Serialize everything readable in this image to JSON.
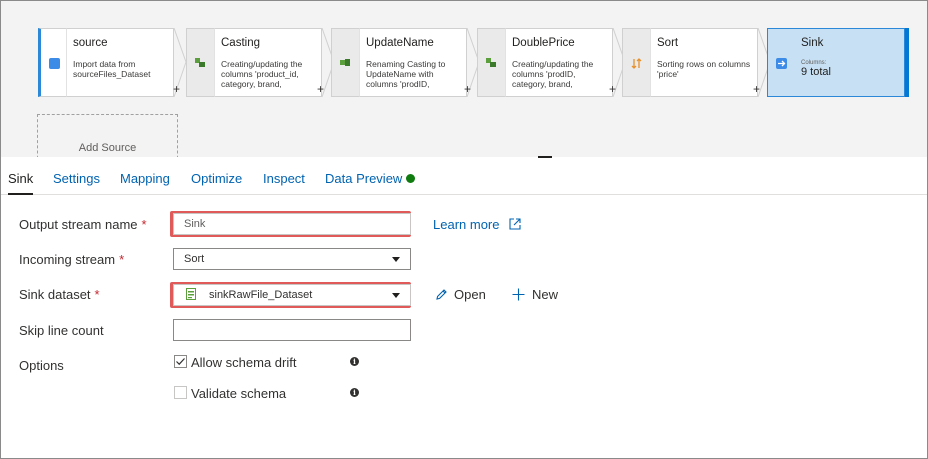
{
  "pipeline": {
    "nodes": [
      {
        "title": "source",
        "description": "Import data from sourceFiles_Dataset"
      },
      {
        "title": "Casting",
        "description": "Creating/updating the columns 'product_id, category, brand,"
      },
      {
        "title": "UpdateName",
        "description": "Renaming Casting to UpdateName with columns 'prodID,"
      },
      {
        "title": "DoublePrice",
        "description": "Creating/updating the columns 'prodID, category, brand,"
      },
      {
        "title": "Sort",
        "description": "Sorting rows on columns 'price'"
      }
    ],
    "sink": {
      "title": "Sink",
      "columns_label": "Columns:",
      "columns_value": "9 total"
    },
    "add_plus": "+",
    "add_source": "Add Source"
  },
  "tabs": [
    "Sink",
    "Settings",
    "Mapping",
    "Optimize",
    "Inspect",
    "Data Preview"
  ],
  "status_color": "#107c10",
  "form": {
    "output_stream": {
      "label": "Output stream name",
      "required": "*",
      "value": "Sink"
    },
    "learn_more": "Learn more",
    "incoming_stream": {
      "label": "Incoming stream",
      "required": "*",
      "value": "Sort"
    },
    "sink_dataset": {
      "label": "Sink dataset",
      "required": "*",
      "value": "sinkRawFile_Dataset"
    },
    "open_label": "Open",
    "new_label": "New",
    "skip_line_count": {
      "label": "Skip line count",
      "value": ""
    },
    "options": {
      "label": "Options",
      "allow_schema_drift": {
        "label": "Allow schema drift",
        "checked": true
      },
      "validate_schema": {
        "label": "Validate schema",
        "checked": false
      }
    }
  },
  "colors": {
    "accent": "#0078d4",
    "link": "#0063b1",
    "highlight": "#e05a5a",
    "sink_bg": "#c7e0f4"
  }
}
